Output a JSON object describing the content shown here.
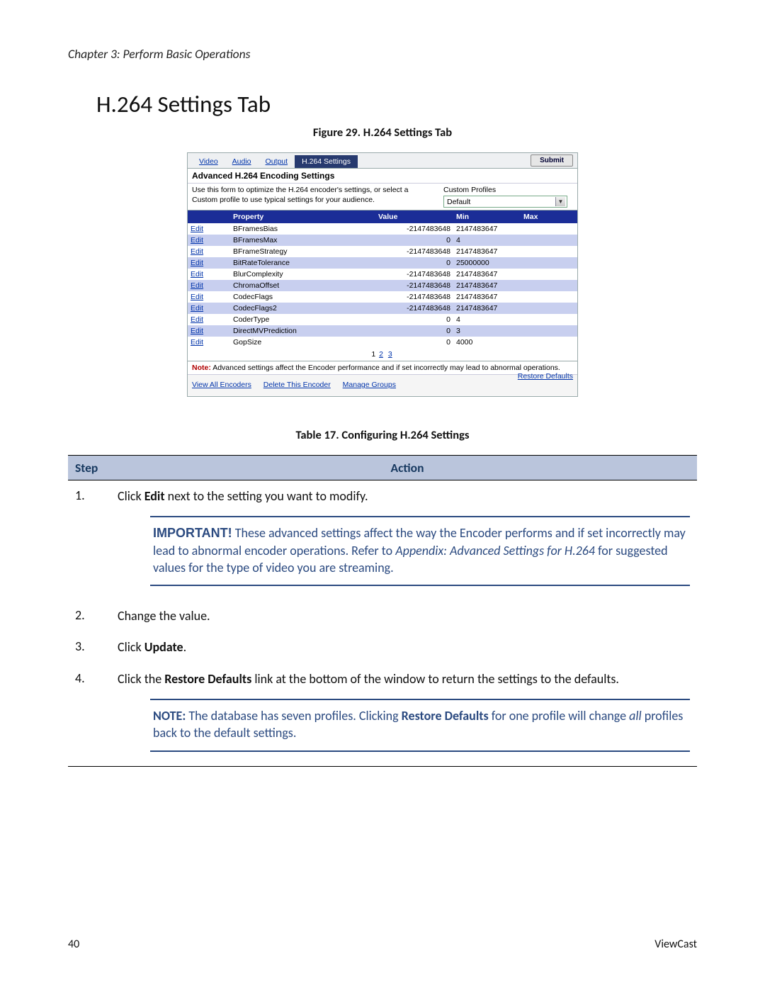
{
  "chapter": "Chapter 3: Perform Basic Operations",
  "heading": "H.264 Settings Tab",
  "figure_caption": "Figure 29. H.264 Settings Tab",
  "shot": {
    "tabs": [
      "Video",
      "Audio",
      "Output",
      "H.264 Settings"
    ],
    "active_tab_index": 3,
    "submit": "Submit",
    "panel_title": "Advanced H.264 Encoding Settings",
    "panel_desc": "Use this form to optimize the H.264 encoder's settings, or select a Custom profile to use typical settings for your audience.",
    "custom_label": "Custom Profiles",
    "custom_value": "Default",
    "columns": {
      "edit": "",
      "property": "Property",
      "value": "Value",
      "min": "Min",
      "max": "Max"
    },
    "edit_label": "Edit",
    "rows": [
      {
        "property": "BFramesBias",
        "value": "-2147483648",
        "min": "2147483647",
        "max": ""
      },
      {
        "property": "BFramesMax",
        "value": "0",
        "min": "4",
        "max": ""
      },
      {
        "property": "BFrameStrategy",
        "value": "-2147483648",
        "min": "2147483647",
        "max": ""
      },
      {
        "property": "BitRateTolerance",
        "value": "0",
        "min": "25000000",
        "max": ""
      },
      {
        "property": "BlurComplexity",
        "value": "-2147483648",
        "min": "2147483647",
        "max": ""
      },
      {
        "property": "ChromaOffset",
        "value": "-2147483648",
        "min": "2147483647",
        "max": ""
      },
      {
        "property": "CodecFlags",
        "value": "-2147483648",
        "min": "2147483647",
        "max": ""
      },
      {
        "property": "CodecFlags2",
        "value": "-2147483648",
        "min": "2147483647",
        "max": ""
      },
      {
        "property": "CoderType",
        "value": "0",
        "min": "4",
        "max": ""
      },
      {
        "property": "DirectMVPrediction",
        "value": "0",
        "min": "3",
        "max": ""
      },
      {
        "property": "GopSize",
        "value": "0",
        "min": "4000",
        "max": ""
      }
    ],
    "pager": {
      "current": "1",
      "links": [
        "2",
        "3"
      ]
    },
    "note_label": "Note:",
    "note_text": " Advanced settings affect the Encoder performance and if set incorrectly may lead to abnormal operations.",
    "restore": "Restore Defaults",
    "bottom_links": [
      "View All Encoders",
      "Delete This Encoder",
      "Manage Groups"
    ]
  },
  "table_caption": "Table 17. Configuring H.264 Settings",
  "inst": {
    "head_step": "Step",
    "head_action": "Action",
    "steps": [
      {
        "n": "1.",
        "pre": "Click ",
        "bold": "Edit",
        "post": " next to the setting you want to modify."
      },
      {
        "n": "2.",
        "pre": "Change the value.",
        "bold": "",
        "post": ""
      },
      {
        "n": "3.",
        "pre": "Click ",
        "bold": "Update",
        "post": "."
      },
      {
        "n": "4.",
        "pre": "Click the ",
        "bold": "Restore Defaults",
        "post": " link at the bottom of the window to return the settings to the defaults."
      }
    ],
    "important_lead": "IMPORTANT!",
    "important_body_1": " These advanced settings affect the way the Encoder performs and if set incorrectly may lead to abnormal encoder operations. Refer to ",
    "important_ital": "Appendix: Advanced Settings for H.264",
    "important_body_2": " for suggested values for the type of video you are streaming.",
    "note_lead": "NOTE:",
    "note_body_1": " The database has seven profiles. Clicking ",
    "note_bold": "Restore Defaults",
    "note_body_2": " for one profile will change ",
    "note_ital": "all",
    "note_body_3": " profiles back to the default settings."
  },
  "footer": {
    "page": "40",
    "brand": "ViewCast"
  }
}
